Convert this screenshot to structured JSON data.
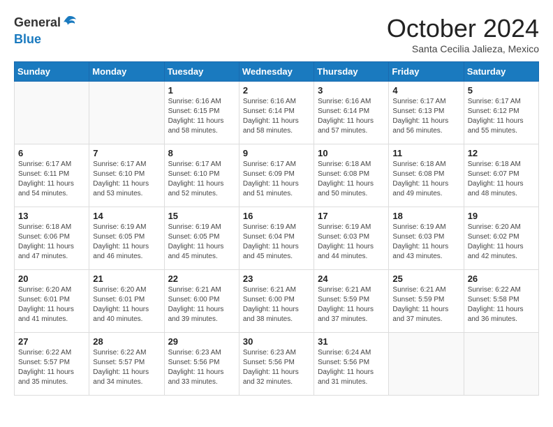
{
  "header": {
    "logo_general": "General",
    "logo_blue": "Blue",
    "month": "October 2024",
    "location": "Santa Cecilia Jalieza, Mexico"
  },
  "days_of_week": [
    "Sunday",
    "Monday",
    "Tuesday",
    "Wednesday",
    "Thursday",
    "Friday",
    "Saturday"
  ],
  "weeks": [
    [
      {
        "day": "",
        "info": ""
      },
      {
        "day": "",
        "info": ""
      },
      {
        "day": "1",
        "info": "Sunrise: 6:16 AM\nSunset: 6:15 PM\nDaylight: 11 hours and 58 minutes."
      },
      {
        "day": "2",
        "info": "Sunrise: 6:16 AM\nSunset: 6:14 PM\nDaylight: 11 hours and 58 minutes."
      },
      {
        "day": "3",
        "info": "Sunrise: 6:16 AM\nSunset: 6:14 PM\nDaylight: 11 hours and 57 minutes."
      },
      {
        "day": "4",
        "info": "Sunrise: 6:17 AM\nSunset: 6:13 PM\nDaylight: 11 hours and 56 minutes."
      },
      {
        "day": "5",
        "info": "Sunrise: 6:17 AM\nSunset: 6:12 PM\nDaylight: 11 hours and 55 minutes."
      }
    ],
    [
      {
        "day": "6",
        "info": "Sunrise: 6:17 AM\nSunset: 6:11 PM\nDaylight: 11 hours and 54 minutes."
      },
      {
        "day": "7",
        "info": "Sunrise: 6:17 AM\nSunset: 6:10 PM\nDaylight: 11 hours and 53 minutes."
      },
      {
        "day": "8",
        "info": "Sunrise: 6:17 AM\nSunset: 6:10 PM\nDaylight: 11 hours and 52 minutes."
      },
      {
        "day": "9",
        "info": "Sunrise: 6:17 AM\nSunset: 6:09 PM\nDaylight: 11 hours and 51 minutes."
      },
      {
        "day": "10",
        "info": "Sunrise: 6:18 AM\nSunset: 6:08 PM\nDaylight: 11 hours and 50 minutes."
      },
      {
        "day": "11",
        "info": "Sunrise: 6:18 AM\nSunset: 6:08 PM\nDaylight: 11 hours and 49 minutes."
      },
      {
        "day": "12",
        "info": "Sunrise: 6:18 AM\nSunset: 6:07 PM\nDaylight: 11 hours and 48 minutes."
      }
    ],
    [
      {
        "day": "13",
        "info": "Sunrise: 6:18 AM\nSunset: 6:06 PM\nDaylight: 11 hours and 47 minutes."
      },
      {
        "day": "14",
        "info": "Sunrise: 6:19 AM\nSunset: 6:05 PM\nDaylight: 11 hours and 46 minutes."
      },
      {
        "day": "15",
        "info": "Sunrise: 6:19 AM\nSunset: 6:05 PM\nDaylight: 11 hours and 45 minutes."
      },
      {
        "day": "16",
        "info": "Sunrise: 6:19 AM\nSunset: 6:04 PM\nDaylight: 11 hours and 45 minutes."
      },
      {
        "day": "17",
        "info": "Sunrise: 6:19 AM\nSunset: 6:03 PM\nDaylight: 11 hours and 44 minutes."
      },
      {
        "day": "18",
        "info": "Sunrise: 6:19 AM\nSunset: 6:03 PM\nDaylight: 11 hours and 43 minutes."
      },
      {
        "day": "19",
        "info": "Sunrise: 6:20 AM\nSunset: 6:02 PM\nDaylight: 11 hours and 42 minutes."
      }
    ],
    [
      {
        "day": "20",
        "info": "Sunrise: 6:20 AM\nSunset: 6:01 PM\nDaylight: 11 hours and 41 minutes."
      },
      {
        "day": "21",
        "info": "Sunrise: 6:20 AM\nSunset: 6:01 PM\nDaylight: 11 hours and 40 minutes."
      },
      {
        "day": "22",
        "info": "Sunrise: 6:21 AM\nSunset: 6:00 PM\nDaylight: 11 hours and 39 minutes."
      },
      {
        "day": "23",
        "info": "Sunrise: 6:21 AM\nSunset: 6:00 PM\nDaylight: 11 hours and 38 minutes."
      },
      {
        "day": "24",
        "info": "Sunrise: 6:21 AM\nSunset: 5:59 PM\nDaylight: 11 hours and 37 minutes."
      },
      {
        "day": "25",
        "info": "Sunrise: 6:21 AM\nSunset: 5:59 PM\nDaylight: 11 hours and 37 minutes."
      },
      {
        "day": "26",
        "info": "Sunrise: 6:22 AM\nSunset: 5:58 PM\nDaylight: 11 hours and 36 minutes."
      }
    ],
    [
      {
        "day": "27",
        "info": "Sunrise: 6:22 AM\nSunset: 5:57 PM\nDaylight: 11 hours and 35 minutes."
      },
      {
        "day": "28",
        "info": "Sunrise: 6:22 AM\nSunset: 5:57 PM\nDaylight: 11 hours and 34 minutes."
      },
      {
        "day": "29",
        "info": "Sunrise: 6:23 AM\nSunset: 5:56 PM\nDaylight: 11 hours and 33 minutes."
      },
      {
        "day": "30",
        "info": "Sunrise: 6:23 AM\nSunset: 5:56 PM\nDaylight: 11 hours and 32 minutes."
      },
      {
        "day": "31",
        "info": "Sunrise: 6:24 AM\nSunset: 5:56 PM\nDaylight: 11 hours and 31 minutes."
      },
      {
        "day": "",
        "info": ""
      },
      {
        "day": "",
        "info": ""
      }
    ]
  ]
}
